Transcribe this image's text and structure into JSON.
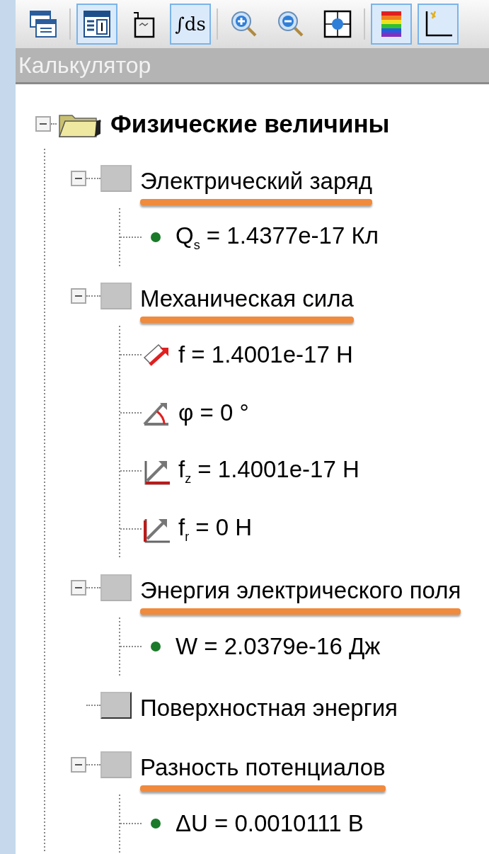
{
  "toolbar": [
    {
      "kind": "windows",
      "selected": false
    },
    {
      "kind": "separator"
    },
    {
      "kind": "table",
      "selected": true
    },
    {
      "kind": "clipboard",
      "selected": false
    },
    {
      "kind": "integral",
      "label": "∫ds",
      "selected": true
    },
    {
      "kind": "separator"
    },
    {
      "kind": "zoom-in",
      "selected": false
    },
    {
      "kind": "zoom-out",
      "selected": false
    },
    {
      "kind": "fit",
      "selected": false
    },
    {
      "kind": "separator"
    },
    {
      "kind": "palette",
      "selected": true
    },
    {
      "kind": "axes",
      "selected": true
    }
  ],
  "panel": {
    "title": "Калькулятор"
  },
  "tree": {
    "label": "Физические величины",
    "expanded": true,
    "children": [
      {
        "label": "Электрический заряд",
        "expanded": true,
        "underlined": true,
        "children": [
          {
            "kind": "dot",
            "label": "Q$_{s}$ = 1.4377e-17 Кл"
          }
        ]
      },
      {
        "label": "Механическая сила",
        "expanded": true,
        "underlined": true,
        "children": [
          {
            "kind": "force",
            "label": "f = 1.4001e-17 Н"
          },
          {
            "kind": "angle",
            "label": "φ = 0 °"
          },
          {
            "kind": "axial",
            "label": "f$_{z}$ = 1.4001e-17 Н"
          },
          {
            "kind": "radial",
            "label": "f$_{r}$ = 0 Н"
          }
        ]
      },
      {
        "label": "Энергия электрического поля",
        "expanded": true,
        "underlined": true,
        "children": [
          {
            "kind": "dot",
            "label": "W = 2.0379e-16 Дж"
          }
        ]
      },
      {
        "label": "Поверхностная энергия",
        "underlined": false
      },
      {
        "label": "Разность потенциалов",
        "expanded": true,
        "underlined": true,
        "children": [
          {
            "kind": "dot",
            "label": "ΔU = 0.0010111 В"
          }
        ]
      }
    ]
  }
}
